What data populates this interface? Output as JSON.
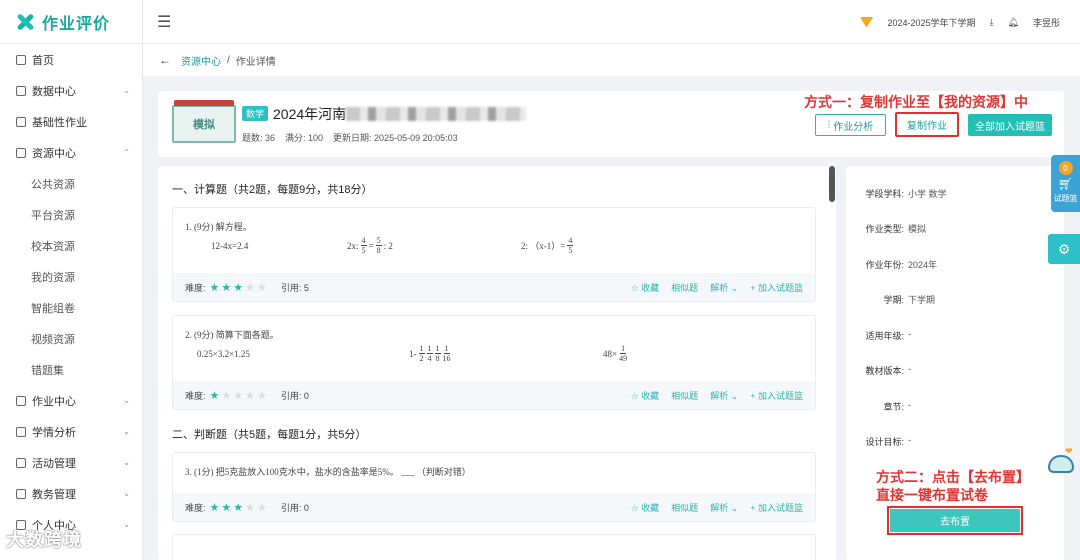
{
  "brand": {
    "name": "作业评价"
  },
  "sidebar": {
    "items": [
      {
        "label": "首页",
        "type": "main"
      },
      {
        "label": "数据中心",
        "type": "main",
        "arrow": "⌄"
      },
      {
        "label": "基础性作业",
        "type": "main"
      },
      {
        "label": "资源中心",
        "type": "main",
        "arrow": "⌃"
      },
      {
        "label": "公共资源",
        "type": "sub"
      },
      {
        "label": "平台资源",
        "type": "sub"
      },
      {
        "label": "校本资源",
        "type": "sub"
      },
      {
        "label": "我的资源",
        "type": "sub"
      },
      {
        "label": "智能组卷",
        "type": "sub"
      },
      {
        "label": "视频资源",
        "type": "sub"
      },
      {
        "label": "错题集",
        "type": "sub"
      },
      {
        "label": "作业中心",
        "type": "main",
        "arrow": "⌄"
      },
      {
        "label": "学情分析",
        "type": "main",
        "arrow": "⌄"
      },
      {
        "label": "活动管理",
        "type": "main",
        "arrow": "⌄"
      },
      {
        "label": "教务管理",
        "type": "main",
        "arrow": "⌄"
      },
      {
        "label": "个人中心",
        "type": "main",
        "arrow": "⌄"
      }
    ]
  },
  "topbar": {
    "term": "2024-2025学年下学期",
    "user": "李昱彤"
  },
  "breadcrumb": {
    "parent": "资源中心",
    "separator": "/",
    "current": "作业详情"
  },
  "paper": {
    "cover_label": "模拟",
    "subject_tag": "数学",
    "title": "2024年河南",
    "question_count": "题数: 36",
    "full_score": "满分: 100",
    "updated": "更新日期: 2025-05-09 20:05:03"
  },
  "buttons": {
    "analysis": "作业分析",
    "copy": "复制作业",
    "add_all": "全部加入试题篮",
    "assign": "去布置"
  },
  "annotations": {
    "method1": "方式一：复制作业至【我的资源】中",
    "method2_line1": "方式二：点击【去布置】",
    "method2_line2": "直接一键布置试卷"
  },
  "sections": {
    "calc": "一、计算题（共2题，每题9分，共18分）",
    "judge": "二、判断题（共5题，每题1分，共5分）"
  },
  "questions": {
    "q1": {
      "text": "1. (9分) 解方程。",
      "e1": "12-4x=2.4",
      "e2a": "2x:",
      "e2n1": "4",
      "e2d1": "5",
      "e2b": "=",
      "e2n2": "5",
      "e2d2": "8",
      "e2c": ": 2",
      "e3a": "2: （x-1）=",
      "e3n": "4",
      "e3d": "5",
      "cite": "引用: 5"
    },
    "q2": {
      "text": "2. (9分) 简算下面各题。",
      "e1": "0.25×3.2×1.25",
      "e2a": "1-",
      "e2n1": "1",
      "e2d1": "2",
      "e2n2": "1",
      "e2d2": "4",
      "e2n3": "1",
      "e2d3": "8",
      "e2n4": "1",
      "e2d4": "16",
      "e3a": "48×",
      "e3n": "1",
      "e3d": "49",
      "cite": "引用: 0"
    },
    "q3": {
      "text": "3. (1分) 把5克盐放入100克水中，盐水的含盐率是5%。 ___ （判断对错）",
      "cite": "引用: 0"
    }
  },
  "q_labels": {
    "difficulty": "难度:",
    "collect": "☆ 收藏",
    "similar": "相似题",
    "analysis": "解析 ⌄",
    "add": "+ 加入试题篮"
  },
  "ratings": {
    "q1": 3,
    "q2": 1,
    "q3": 3,
    "max": 5
  },
  "info": {
    "labels": [
      "学段学科:",
      "作业类型:",
      "作业年份:",
      "学期:",
      "适用年级:",
      "教材版本:",
      "章节:",
      "设计目标:"
    ],
    "values": [
      "小学 数学",
      "模拟",
      "2024年",
      "下学期",
      "-",
      "-",
      "-",
      "-"
    ]
  },
  "basket": {
    "count": "0",
    "label": "试题篮"
  },
  "watermark": "大数跨境",
  "colors": {
    "accent": "#22c0b4",
    "annotation": "#e03030"
  }
}
